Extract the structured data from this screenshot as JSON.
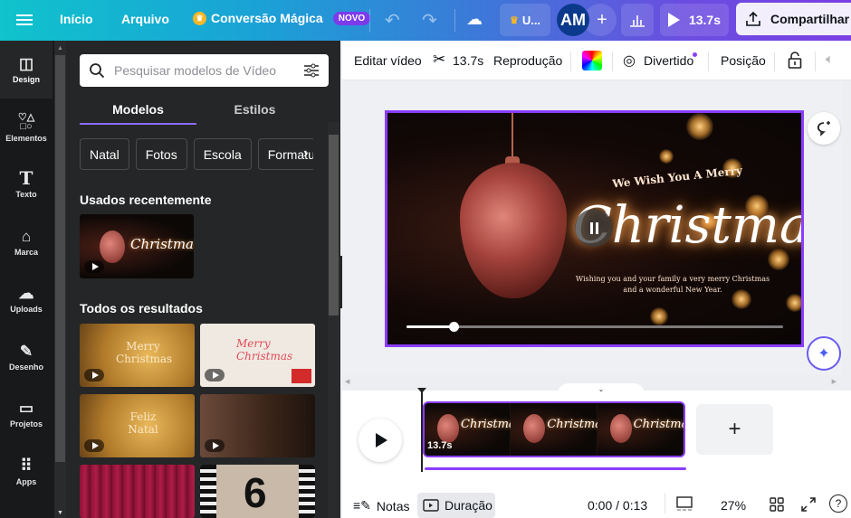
{
  "topbar": {
    "home": "Início",
    "file": "Arquivo",
    "magic": "Conversão Mágica",
    "magic_badge": "NOVO",
    "team": "U...",
    "avatar": "AM",
    "play_duration": "13.7s",
    "share": "Compartilhar",
    "gradient": [
      "#10c3cc",
      "#7b3fe4"
    ]
  },
  "rail": {
    "items": [
      {
        "label": "Design",
        "icon": "layout-icon",
        "glyph": "◫"
      },
      {
        "label": "Elementos",
        "icon": "shapes-icon",
        "glyph": "♡△"
      },
      {
        "label": "Texto",
        "icon": "text-icon",
        "glyph": "T"
      },
      {
        "label": "Marca",
        "icon": "brand-icon",
        "glyph": "⌂"
      },
      {
        "label": "Uploads",
        "icon": "upload-cloud-icon",
        "glyph": "☁"
      },
      {
        "label": "Desenho",
        "icon": "draw-icon",
        "glyph": "✎"
      },
      {
        "label": "Projetos",
        "icon": "folder-icon",
        "glyph": "▭"
      },
      {
        "label": "Apps",
        "icon": "apps-grid-icon",
        "glyph": "⠿"
      }
    ]
  },
  "panel": {
    "search_placeholder": "Pesquisar modelos de Vídeo",
    "search_value": "",
    "tabs": [
      "Modelos",
      "Estilos"
    ],
    "chips": [
      "Natal",
      "Fotos",
      "Escola",
      "Formatura"
    ],
    "recent_heading": "Usados recentemente",
    "all_heading": "Todos os resultados",
    "recent_templates": [
      {
        "title": "Christmas"
      }
    ],
    "results": [
      {
        "title": "Merry Christmas"
      },
      {
        "title": "Merry Christmas"
      },
      {
        "title": "Feliz Natal"
      },
      {
        "title": ""
      },
      {
        "title": ""
      },
      {
        "title": "6"
      }
    ]
  },
  "context_toolbar": {
    "edit_video": "Editar vídeo",
    "trim_duration": "13.7s",
    "playback": "Reprodução",
    "animation": "Divertido",
    "position": "Posição"
  },
  "canvas": {
    "video": {
      "heading_small": "We Wish You A Merry",
      "heading_big": "Christmas",
      "message_line1": "Wishing you and your family a very merry Christmas",
      "message_line2": "and a wonderful New Year.",
      "progress": 0.125
    }
  },
  "timeline": {
    "clip_duration": "13.7s",
    "clip_frames": [
      "Christmas",
      "Christmas",
      "Christmas"
    ]
  },
  "footer": {
    "notes": "Notas",
    "duration": "Duração",
    "time": "0:00 / 0:13",
    "zoom": "27%"
  },
  "colors": {
    "accent": "#8b3dff",
    "panel_bg": "#252627",
    "rail_bg": "#18191b"
  }
}
